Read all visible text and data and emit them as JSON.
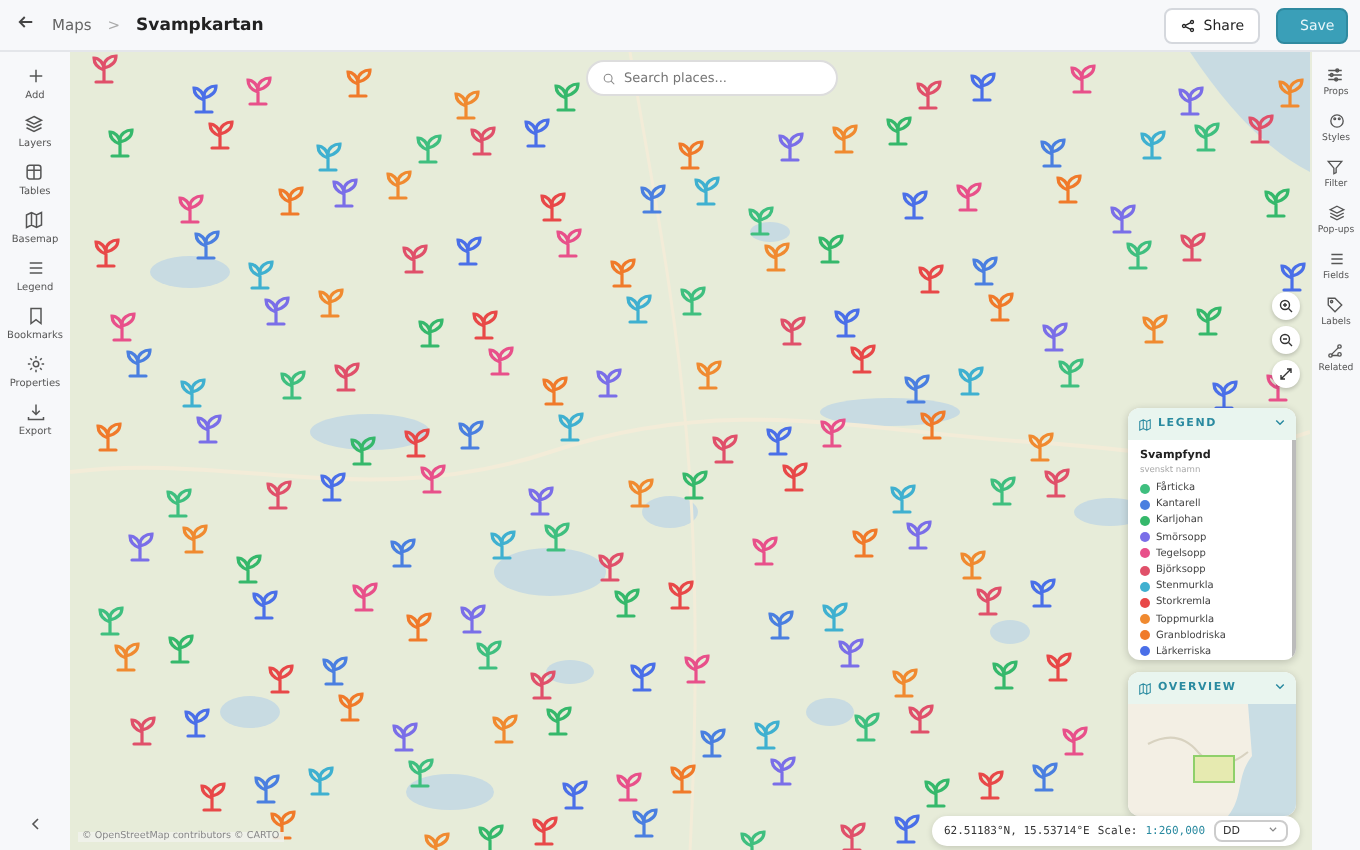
{
  "header": {
    "breadcrumb": "Maps",
    "separator": ">",
    "title": "Svampkartan",
    "buttons": [
      {
        "kind": "share",
        "label": "Share"
      },
      {
        "kind": "save",
        "label": "Save"
      }
    ]
  },
  "left_toolbar": [
    {
      "label": "Add"
    },
    {
      "label": "Layers"
    },
    {
      "label": "Tables"
    },
    {
      "label": "Basemap"
    },
    {
      "label": "Legend"
    },
    {
      "label": "Bookmarks"
    },
    {
      "label": "Properties"
    },
    {
      "label": "Export"
    }
  ],
  "right_toolbar": [
    {
      "label": "Props"
    },
    {
      "label": "Styles"
    },
    {
      "label": "Filter"
    },
    {
      "label": "Pop-ups"
    },
    {
      "label": "Fields"
    },
    {
      "label": "Labels"
    },
    {
      "label": "Related"
    }
  ],
  "search": {
    "placeholder": "Search places..."
  },
  "legend": {
    "title": "LEGEND",
    "expanded": true,
    "layer": "Svampfynd",
    "field": "svenskt namn",
    "items": [
      {
        "label": "Fårticka",
        "color": "#3fbf7f"
      },
      {
        "label": "Kantarell",
        "color": "#4a7fe0"
      },
      {
        "label": "Karljohan",
        "color": "#35b86b"
      },
      {
        "label": "Smörsopp",
        "color": "#7a6ee8"
      },
      {
        "label": "Tegelsopp",
        "color": "#e8508a"
      },
      {
        "label": "Björksopp",
        "color": "#e0506a"
      },
      {
        "label": "Stenmurkla",
        "color": "#3fb0d0"
      },
      {
        "label": "Storkremla",
        "color": "#e84848"
      },
      {
        "label": "Toppmurkla",
        "color": "#f08a30"
      },
      {
        "label": "Granblodriska",
        "color": "#f07a2a"
      },
      {
        "label": "Lärkerriska",
        "color": "#4a6fe8"
      }
    ]
  },
  "overview": {
    "title": "OVERVIEW",
    "expanded": true
  },
  "attribution": "© OpenStreetMap contributors © CARTO",
  "status_bar": {
    "coordinates": "62.51183°N, 15.53714°E",
    "scale_label": "Scale:",
    "scale": "1:260,000",
    "format": "DD"
  }
}
